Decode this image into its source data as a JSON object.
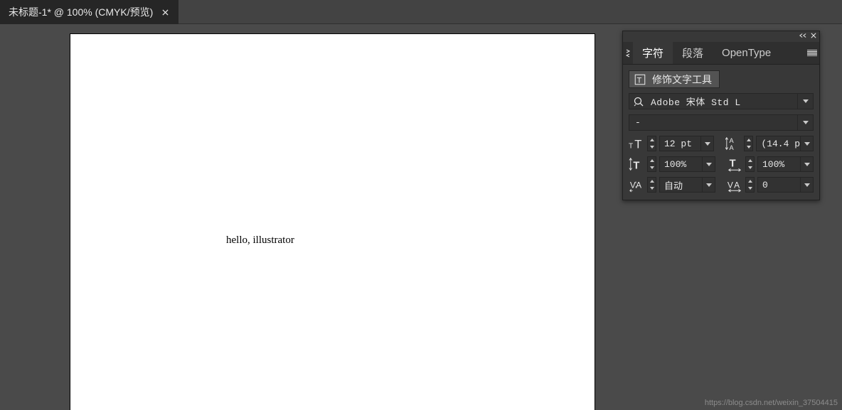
{
  "tab": {
    "title": "未标题-1* @ 100% (CMYK/预览)"
  },
  "canvas": {
    "text": "hello, illustrator"
  },
  "panel": {
    "tabs": {
      "char": "字符",
      "para": "段落",
      "ot": "OpenType"
    },
    "touchup_label": "修饰文字工具",
    "font_family": "Adobe 宋体 Std L",
    "font_style": "-",
    "props": {
      "font_size": "12 pt",
      "leading": "(14.4 p",
      "v_scale": "100%",
      "h_scale": "100%",
      "kerning": "自动",
      "tracking": "0"
    }
  },
  "watermark": "https://blog.csdn.net/weixin_37504415"
}
